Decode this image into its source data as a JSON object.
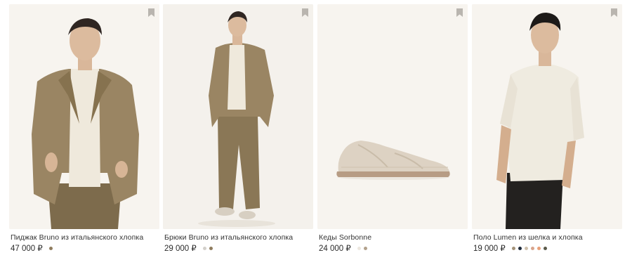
{
  "products": [
    {
      "title": "Пиджак Bruno из итальянского хлопка",
      "price": "47 000 ₽",
      "image": "model-in-olive-blazer-photo",
      "colors": [
        "#8f7c5e"
      ]
    },
    {
      "title": "Брюки Bruno из итальянского хлопка",
      "price": "29 000 ₽",
      "image": "model-in-olive-suit-photo",
      "colors": [
        "#d3d0cb",
        "#8f7c5e"
      ]
    },
    {
      "title": "Кеды Sorbonne",
      "price": "24 000 ₽",
      "image": "beige-sneaker-photo",
      "colors": [
        "#ece7df",
        "#b2a18c"
      ]
    },
    {
      "title": "Поло Lumen из шелка и хлопка",
      "price": "19 000 ₽",
      "image": "model-in-cream-polo-photo",
      "colors": [
        "#a39279",
        "#1e2a3a",
        "#cdbfab",
        "#d8a48c",
        "#e8a07a",
        "#5a5a4a"
      ]
    }
  ],
  "icons": {
    "bookmark": "bookmark-icon"
  },
  "colors": {
    "photo_bg": "#f7f4ef",
    "text": "#2b2b2b",
    "bookmark": "#b9b5af"
  }
}
